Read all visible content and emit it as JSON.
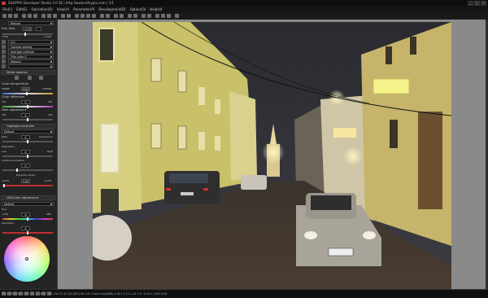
{
  "window": {
    "title": "SILKYPIX Developer Studio 3.0 SE | http://www.isilkypix.com | 1/1",
    "buttons": [
      "_",
      "□",
      "×"
    ]
  },
  "menu": [
    "File(F)",
    "Edit(E)",
    "Operation(O)",
    "View(V)",
    "Parameter(P)",
    "Development(D)",
    "Option(O)",
    "Help(H)"
  ],
  "panel": {
    "preset_label": "Manual",
    "exposure_label": "Exp. bias",
    "exposure_value": "-0.33",
    "exposure_min": "-3.00",
    "exposure_max": "+3.00",
    "ev_label": "0.0",
    "camera_setting": "Camera setting",
    "contrast_setting": "Average contrast",
    "film_color": "Film color 0",
    "natural": "Natural",
    "white_balance_header": "White balance",
    "color_temp_label": "Color temperature",
    "color_temp_value": "5000",
    "color_temp_min": "2000K",
    "color_temp_max": "10000K",
    "color_deflection_label": "Color deflection",
    "color_deflection_value": "0",
    "color_deflection_min": "-50",
    "color_deflection_max": "+50",
    "dark_adjust_label": "Dark adjustment",
    "dark_adjust_value": "0",
    "dark_adjust_min": "-50",
    "dark_adjust_max": "+50",
    "highlight_header": "Highlight controller",
    "highlight_preset": "Default",
    "highlight_value": "0",
    "highlight_min": "Dark",
    "highlight_max": "Luminance",
    "saturation_label": "Saturation",
    "saturation_value": "0",
    "saturation_min": "Low",
    "saturation_max": "High",
    "luminance_label": "Luminance restore",
    "luminance_value": "0",
    "dynamic_range_label": "Dynamic range",
    "dynamic_range_value": "0.00",
    "dynamic_range_min": "+0.00",
    "dynamic_range_max": "+4.00",
    "hsl_header": "HSL/Color adjustment",
    "hsl_preset": "Default",
    "hue_label": "Hue",
    "hue_value": "0",
    "hue_min": "+179",
    "hue_max": "-180",
    "sat2_label": "Saturation",
    "sat2_value": "0"
  },
  "status": {
    "text": "P0017595.ERF 2007.03.14 19:17 ISO 250 F2.8 1/10 [EV] W:1.00 2.5mm Av(RAW) 4.00 / 4.12   L-15.7 H: 3.00 L: 3.60 0:04"
  }
}
